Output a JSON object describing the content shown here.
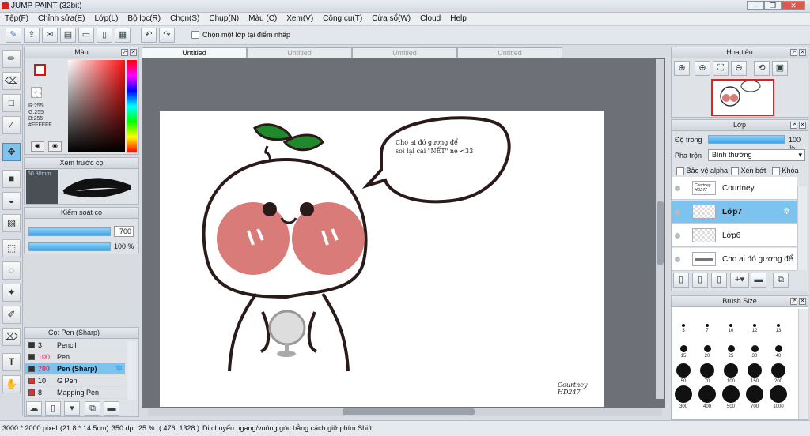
{
  "app": {
    "title": "JUMP PAINT (32bit)"
  },
  "menu": [
    "Tệp(F)",
    "Chỉnh sửa(E)",
    "Lớp(L)",
    "Bộ lọc(R)",
    "Chọn(S)",
    "Chụp(N)",
    "Màu (C)",
    "Xem(V)",
    "Công cụ(T)",
    "Cửa sổ(W)",
    "Cloud",
    "Help"
  ],
  "toolbar": {
    "select_one_layer": "Chọn một lớp tại điểm nhấp"
  },
  "tabs": [
    "Untitled",
    "Untitled",
    "Untitled",
    "Untitled"
  ],
  "color_panel": {
    "title": "Màu",
    "r": "R:255",
    "g": "G:255",
    "b": "B:255",
    "hex": "#FFFFFF"
  },
  "brush_preview": {
    "title": "Xem trước cọ",
    "size": "50.80mm"
  },
  "brush_control": {
    "title": "Kiểm soát cọ",
    "size_value": "700",
    "opacity_value": "100 %"
  },
  "brush_list": {
    "title": "Cọ: Pen (Sharp)",
    "items": [
      {
        "size": "3",
        "name": "Pencil",
        "color": "#333333"
      },
      {
        "size": "100",
        "name": "Pen",
        "color": "#333333"
      },
      {
        "size": "700",
        "name": "Pen (Sharp)",
        "color": "#333333"
      },
      {
        "size": "10",
        "name": "G Pen",
        "color": "#e03030"
      },
      {
        "size": "8",
        "name": "Mapping Pen",
        "color": "#e03030"
      }
    ]
  },
  "navigator": {
    "title": "Hoa tiêu"
  },
  "layers": {
    "title": "Lớp",
    "opacity_label": "Độ trong",
    "opacity_value": "100 %",
    "blend_label": "Pha trộn",
    "blend_value": "Bình thường",
    "protect_alpha": "Bảo vệ alpha",
    "clip": "Xén bớt",
    "lock": "Khóa",
    "items": [
      {
        "name": "Courtney",
        "thumb": "Courtney HD247"
      },
      {
        "name": "Lớp7"
      },
      {
        "name": "Lớp6"
      },
      {
        "name": "Cho ai đó gương để",
        "thumb": "text"
      }
    ]
  },
  "brush_size": {
    "title": "Brush Size",
    "sizes": [
      "3",
      "7",
      "10",
      "12",
      "13",
      "15",
      "20",
      "25",
      "30",
      "40",
      "50",
      "70",
      "100",
      "150",
      "200",
      "300",
      "400",
      "500",
      "700",
      "1000"
    ]
  },
  "canvas_text": {
    "bubble_line1": "Cho ai đó gương để",
    "bubble_line2": "soi lại cái \"NẾT\" nè <33",
    "sign_line1": "Courtney",
    "sign_line2": "HD247"
  },
  "status": {
    "dimensions": "3000 * 2000 pixel",
    "physical": "(21.8 * 14.5cm)",
    "dpi": "350 dpi",
    "zoom": "25 %",
    "coords": "( 476, 1328 )",
    "hint": "Di chuyển ngang/vuông góc bằng cách giữ phím Shift"
  }
}
